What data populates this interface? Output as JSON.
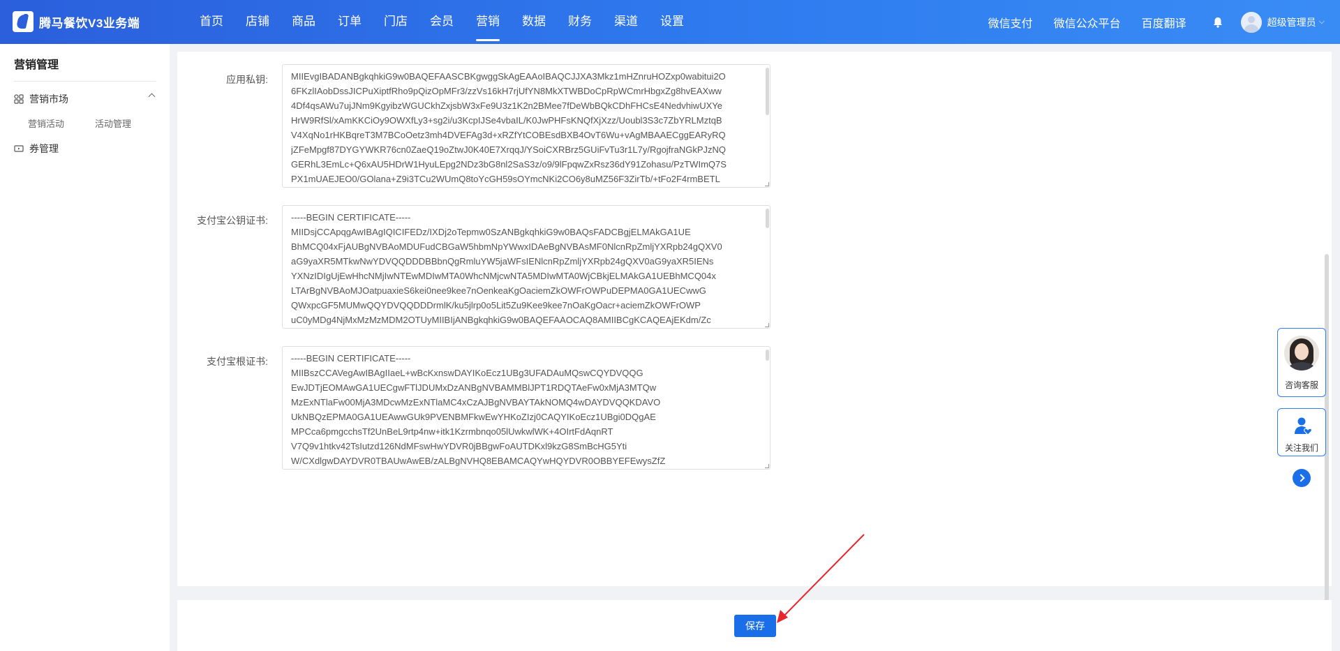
{
  "brand": {
    "name": "腾马餐饮V3业务端"
  },
  "nav": {
    "items": [
      {
        "label": "首页"
      },
      {
        "label": "店铺"
      },
      {
        "label": "商品"
      },
      {
        "label": "订单"
      },
      {
        "label": "门店"
      },
      {
        "label": "会员"
      },
      {
        "label": "营销",
        "active": true
      },
      {
        "label": "数据"
      },
      {
        "label": "财务"
      },
      {
        "label": "渠道"
      },
      {
        "label": "设置"
      }
    ],
    "right_links": [
      {
        "label": "微信支付"
      },
      {
        "label": "微信公众平台"
      },
      {
        "label": "百度翻译"
      }
    ],
    "bell_icon": "bell-icon",
    "user_name": "超级管理员",
    "user_caret": "⌵"
  },
  "sidebar": {
    "title": "营销管理",
    "group": {
      "label": "营销市场",
      "icon": "grid-icon",
      "expanded": true
    },
    "sub_items": [
      {
        "label": "营销活动"
      },
      {
        "label": "活动管理"
      }
    ],
    "item2": {
      "label": "券管理",
      "icon": "ticket-icon"
    }
  },
  "form": {
    "fields": [
      {
        "label": "应用私钥:",
        "lines": [
          "MIIEvgIBADANBgkqhkiG9w0BAQEFAASCBKgwggSkAgEAAoIBAQCJJXA3Mkz1mHZnruHOZxp0wabitui2O",
          "6FKzlIAobDssJICPuXiptfRho9pQizOpMFr3/zzVs16kH7rjUfYN8MkXTWBDoCpRpWCmrHbgxZg8hvEAXww",
          "4Df4qsAWu7ujJNm9KgyibzWGUCkhZxjsbW3xFe9U3z1K2n2BMee7fDeWbBQkCDhFHCsE4NedvhiwUXYe",
          "HrW9RfSl/xAmKKCiOy9OWXfLy3+sg2i/u3KcpIJSe4vbaIL/K0JwPHFsKNQfXjXzz/Uoubl3S3c7ZbYRLMztqB",
          "V4XqNo1rHKBqreT3M7BCoOetz3mh4DVEFAg3d+xRZfYtCOBEsdBXB4OvT6Wu+vAgMBAAECggEARyRQ",
          "jZFeMpgf87DYGYWKR76cn0ZaeQ19oZtwJ0K40E7XrqqJ/YSoiCXRBrz5GUiFvTu3r1L7y/RgojfraNGkPJzNQ",
          "GERhL3EmLc+Q6xAU5HDrW1HyuLEpg2NDz3bG8nl2SaS3z/o9/9lFpqwZxRsz36dY91Zohasu/PzTWImQ7S",
          "PX1mUAEJEO0/GOlana+Z9i3TCu2WUmQ8toYcGH59sOYmcNKi2CO6y8uMZ56F3ZirTb/+tFo2F4rmBETL"
        ]
      },
      {
        "label": "支付宝公钥证书:",
        "lines": [
          "-----BEGIN CERTIFICATE-----",
          "MIIDsjCCApqgAwIBAgIQICIFEDz/IXDj2oTepmw0SzANBgkqhkiG9w0BAQsFADCBgjELMAkGA1UE",
          "BhMCQ04xFjAUBgNVBAoMDUFudCBGaW5hbmNpYWwxIDAeBgNVBAsMF0NlcnRpZmljYXRpb24gQXV0",
          "aG9yaXR5MTkwNwYDVQQDDDBBbnQgRmluYW5jaWFsIENlcnRpZmljYXRpb24gQXV0aG9yaXR5IENs",
          "YXNzIDIgUjEwHhcNMjIwNTEwMDIwMTA0WhcNMjcwNTA5MDIwMTA0WjCBkjELMAkGA1UEBhMCQ04x",
          "LTArBgNVBAoMJOatpuaxieS6kei0nee9kee7nOenkeaKgOaciemZkOWFrOWPuDEPMA0GA1UECwwG",
          "QWxpcGF5MUMwQQYDVQQDDDrmlK/ku5jlrp0o5Lit5Zu9Kee9kee7nOaKgOacr+aciemZkOWFrOWP",
          "uC0yMDg4NjMxMzMzMDM2OTUyMIIBIjANBgkqhkiG9w0BAQEFAAOCAQ8AMIIBCgKCAQEAjEKdm/Zc"
        ]
      },
      {
        "label": "支付宝根证书:",
        "lines": [
          "-----BEGIN CERTIFICATE-----",
          "MIIBszCCAVegAwIBAgIIaeL+wBcKxnswDAYIKoEcz1UBg3UFADAuMQswCQYDVQQG",
          "EwJDTjEOMAwGA1UECgwFTlJDUMxDzANBgNVBAMMBlJPT1RDQTAeFw0xMjA3MTQw",
          "MzExNTlaFw00MjA3MDcwMzExNTlaMC4xCzAJBgNVBAYTAkNOMQ4wDAYDVQQKDAVO",
          "UkNBQzEPMA0GA1UEAwwGUk9PVENBMFkwEwYHKoZIzj0CAQYIKoEcz1UBgi0DQgAE",
          "MPCca6pmgcchsTf2UnBeL9rtp4nw+itk1Kzrmbnqo05lUwkwlWK+4OIrtFdAqnRT",
          "V7Q9v1htkv42TsIutzd126NdMFswHwYDVR0jBBgwFoAUTDKxl9kzG8SmBcHG5Yti",
          "W/CXdlgwDAYDVR0TBAUwAwEB/zALBgNVHQ8EBAMCAQYwHQYDVR0OBBYEFEwysZfZ"
        ]
      }
    ]
  },
  "actions": {
    "save_label": "保存"
  },
  "float": {
    "consult_label": "咨询客服",
    "follow_label": "关注我们",
    "next_icon": "chevron-right-icon"
  },
  "colors": {
    "primary": "#1a6fe8",
    "topbar": "#2b5fdc",
    "annotation_arrow": "#e8262b"
  }
}
